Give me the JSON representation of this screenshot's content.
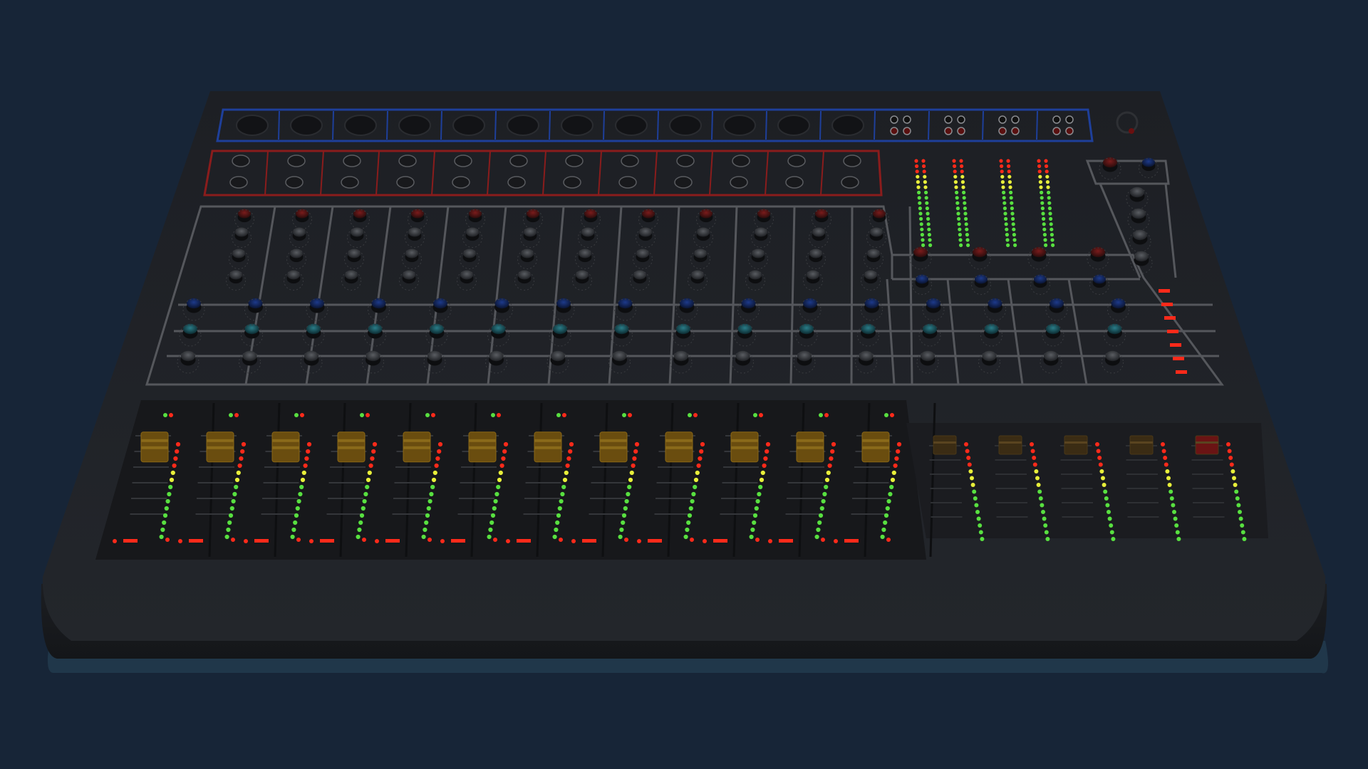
{
  "app": {
    "title": ""
  },
  "colors": {
    "background": "#172537",
    "console_body": "#1a1c20",
    "console_top": "#1f2126",
    "panel_line": "#55575c",
    "input_outline": "#1e3f9a",
    "insert_outline": "#8a1c1c",
    "fader_cap_channel": "#6a4d0f",
    "fader_cap_group": "#3b2c14",
    "fader_cap_master": "#6a1414",
    "led_red": "#ff2a1a",
    "led_yellow": "#e8ef3a",
    "led_green": "#58e040",
    "knob_red": "#5a1414",
    "knob_blue": "#10245a",
    "knob_cyan": "#14505a",
    "knob_grey": "#3a3d42"
  },
  "mixer": {
    "input_channels": 12,
    "group_busses": 4,
    "master_channels": 1,
    "channels": [
      {
        "id": 1,
        "fader": 0.78,
        "meter_lit": 8
      },
      {
        "id": 2,
        "fader": 0.78,
        "meter_lit": 8
      },
      {
        "id": 3,
        "fader": 0.78,
        "meter_lit": 8
      },
      {
        "id": 4,
        "fader": 0.78,
        "meter_lit": 8
      },
      {
        "id": 5,
        "fader": 0.78,
        "meter_lit": 8
      },
      {
        "id": 6,
        "fader": 0.78,
        "meter_lit": 8
      },
      {
        "id": 7,
        "fader": 0.78,
        "meter_lit": 8
      },
      {
        "id": 8,
        "fader": 0.78,
        "meter_lit": 8
      },
      {
        "id": 9,
        "fader": 0.78,
        "meter_lit": 8
      },
      {
        "id": 10,
        "fader": 0.78,
        "meter_lit": 8
      },
      {
        "id": 11,
        "fader": 0.78,
        "meter_lit": 8
      },
      {
        "id": 12,
        "fader": 0.78,
        "meter_lit": 8
      }
    ],
    "groups": [
      {
        "id": 1,
        "fader": 0.8,
        "meter_lit": 13
      },
      {
        "id": 2,
        "fader": 0.8,
        "meter_lit": 13
      },
      {
        "id": 3,
        "fader": 0.8,
        "meter_lit": 13
      },
      {
        "id": 4,
        "fader": 0.8,
        "meter_lit": 13
      }
    ],
    "master": {
      "fader": 0.8,
      "meter_lit": 13
    },
    "stereo_meters": 4,
    "master_meter_red_segments": 7
  }
}
